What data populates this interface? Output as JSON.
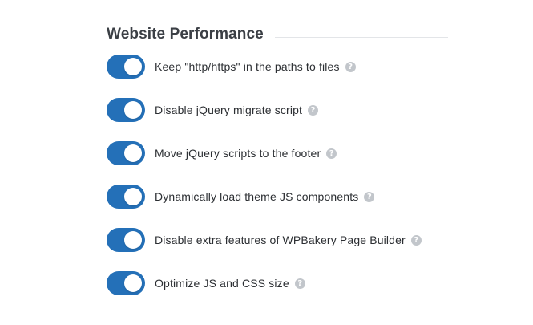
{
  "section": {
    "title": "Website Performance"
  },
  "options": [
    {
      "label": "Keep \"http/https\" in the paths to files",
      "enabled": true,
      "help_glyph": "?"
    },
    {
      "label": "Disable jQuery migrate script",
      "enabled": true,
      "help_glyph": "?"
    },
    {
      "label": "Move jQuery scripts to the footer",
      "enabled": true,
      "help_glyph": "?"
    },
    {
      "label": "Dynamically load theme JS components",
      "enabled": true,
      "help_glyph": "?"
    },
    {
      "label": "Disable extra features of WPBakery Page Builder",
      "enabled": true,
      "help_glyph": "?"
    },
    {
      "label": "Optimize JS and CSS size",
      "enabled": true,
      "help_glyph": "?"
    }
  ],
  "colors": {
    "toggle_on": "#2470b8",
    "toggle_off": "#c7cbd1",
    "help_icon": "#c2c6cb",
    "title_text": "#3b3f45",
    "label_text": "#2c2f33"
  }
}
